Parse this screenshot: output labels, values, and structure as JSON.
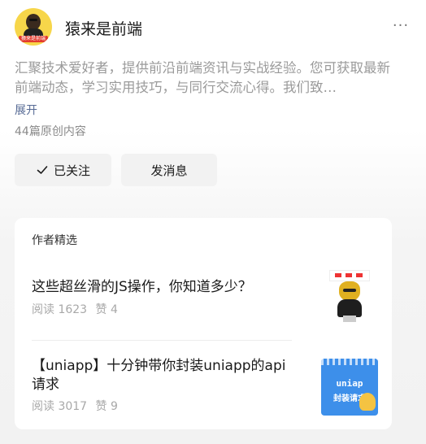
{
  "account": {
    "name": "猿来是前端",
    "avatar_tag": "猿来是前端",
    "more_label": "···",
    "description": "汇聚技术爱好者，提供前沿前端资讯与实战经验。您可获取最新前端动态，学习实用技巧，与同行交流心得。我们致…",
    "expand_label": "展开",
    "article_count": "44篇原创内容"
  },
  "actions": {
    "follow_label": "已关注",
    "message_label": "发消息"
  },
  "featured": {
    "title": "作者精选",
    "items": [
      {
        "title": "这些超丝滑的JS操作，你知道多少？",
        "reads": "阅读 1623",
        "likes": "赞 4"
      },
      {
        "title": "【uniapp】十分钟带你封装uniapp的api请求",
        "reads": "阅读 3017",
        "likes": "赞 9",
        "thumb_line1": "uniap",
        "thumb_line2": "封装请求"
      }
    ]
  },
  "colors": {
    "link": "#576b95",
    "muted": "#9a9a9a",
    "button_bg": "#f2f2f2",
    "thumb2_bg": "#3d8fea"
  }
}
